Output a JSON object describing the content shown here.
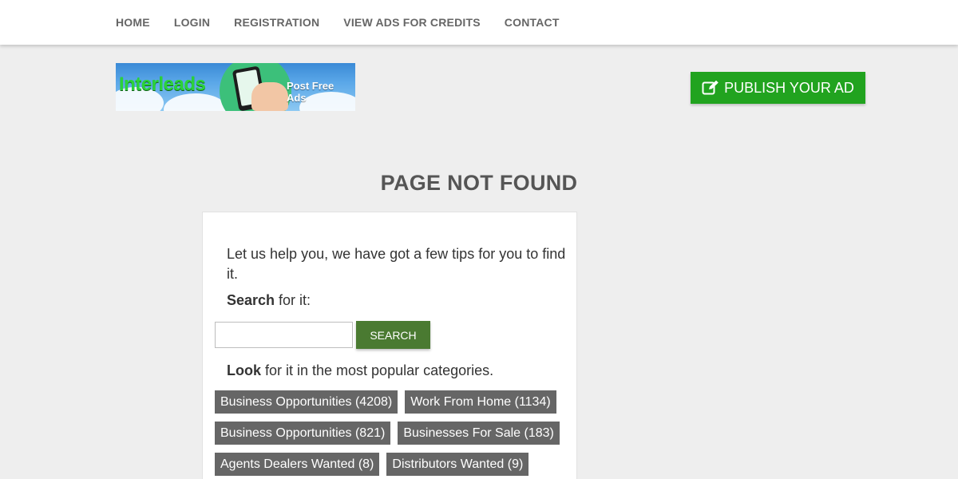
{
  "nav": {
    "items": [
      "HOME",
      "LOGIN",
      "REGISTRATION",
      "VIEW ADS FOR CREDITS",
      "CONTACT"
    ]
  },
  "logo": {
    "brand_text": "Interleads",
    "tagline": "Post Free Ads"
  },
  "publish_button": {
    "label": "PUBLISH YOUR AD",
    "icon": "edit-icon",
    "color": "#21a31f"
  },
  "page_title": "PAGE NOT FOUND",
  "card": {
    "intro": "Let us help you, we have got a few tips for you to find it.",
    "search_strong": "Search",
    "search_rest": " for it:",
    "search_input_value": "",
    "search_button_label": "SEARCH",
    "look_strong": "Look",
    "look_rest": " for it in the most popular categories.",
    "categories": [
      [
        "Business Opportunities (4208)",
        "Work From Home (1134)"
      ],
      [
        "Business Opportunities (821)",
        "Businesses For Sale (183)"
      ],
      [
        "Agents Dealers Wanted (8)",
        "Distributors Wanted (9)"
      ]
    ]
  },
  "colors": {
    "accent_green": "#21a31f",
    "search_button": "#4a7a31",
    "category_tag": "#666666"
  }
}
